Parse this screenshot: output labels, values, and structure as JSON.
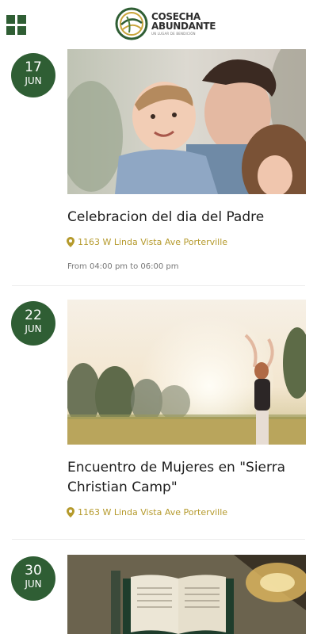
{
  "header": {
    "menu_icon": "grid-menu-icon",
    "logo": {
      "line1": "COSECHA",
      "line2": "ABUNDANTE",
      "tagline": "UN LUGAR DE BENDICIÓN"
    }
  },
  "colors": {
    "brand_green": "#2f5e34",
    "accent_gold": "#b59a2c",
    "muted_text": "#777777"
  },
  "events": [
    {
      "day": "17",
      "month": "JUN",
      "title": "Celebracion del dia del Padre",
      "location": "1163 W Linda Vista Ave Porterville",
      "time": "From 04:00 pm to 06:00 pm",
      "image_icon": "father-with-children-photo"
    },
    {
      "day": "22",
      "month": "JUN",
      "title": "Encuentro de Mujeres en \"Sierra Christian Camp\"",
      "location": "1163 W Linda Vista Ave Porterville",
      "image_icon": "woman-in-field-photo"
    },
    {
      "day": "30",
      "month": "JUN",
      "image_icon": "open-bible-photo"
    }
  ]
}
